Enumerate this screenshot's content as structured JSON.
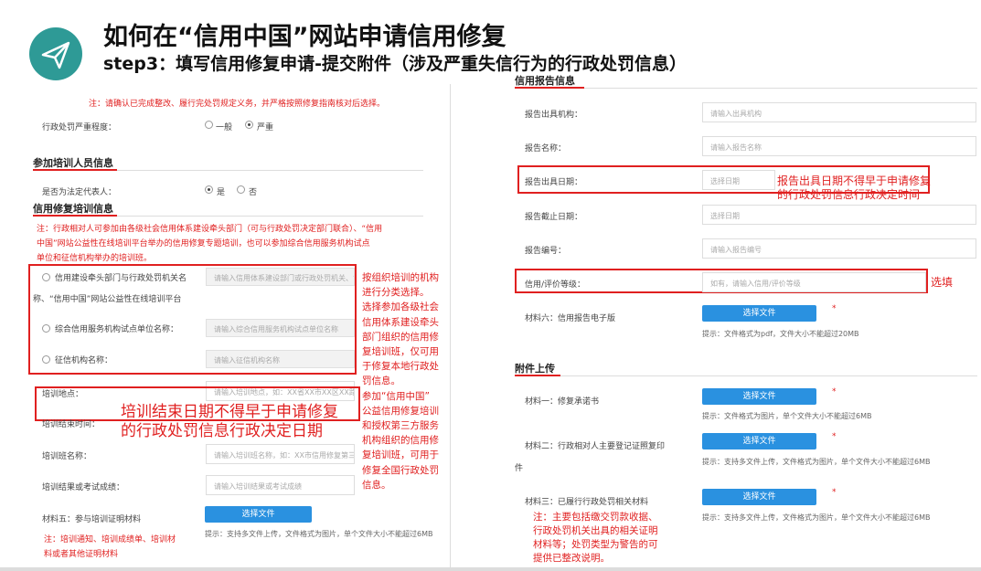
{
  "header": {
    "title": "如何在“信用中国”网站申请信用修复",
    "subtitle": "step3：填写信用修复申请-提交附件（涉及严重失信行为的行政处罚信息）"
  },
  "left": {
    "top_note": "注：请确认已完成整改、履行完处罚规定义务，并严格按照修复指南核对后选择。",
    "severity_label": "行政处罚严重程度：",
    "severity_options": [
      "一般",
      "严重"
    ],
    "section_training_person": "参加培训人员信息",
    "legal_rep_label": "是否为法定代表人：",
    "legal_rep_options": [
      "是",
      "否"
    ],
    "section_training_info": "信用修复培训信息",
    "training_note_1": "注：行政相对人可参加由各级社会信用体系建设牵头部门（可与行政处罚决定部门联合）、“信用",
    "training_note_2": "中国”网站公益性在线培训平台举办的信用修复专题培训，也可以参加综合信用服务机构试点",
    "training_note_3": "单位和征信机构举办的培训班。",
    "org_option_1_line1": "信用建设牵头部门与行政处罚机关名",
    "org_option_1_line2": "称、“信用中国”网站公益性在线培训平台",
    "org_option_1_placeholder": "请输入信用体系建设部门或行政处罚机关、“信",
    "org_option_2": "综合信用服务机构试点单位名称：",
    "org_option_2_placeholder": "请输入综合信用服务机构试点单位名称",
    "org_option_3": "征信机构名称：",
    "org_option_3_placeholder": "请输入征信机构名称",
    "location_label": "培训地点：",
    "location_placeholder": "请输入培训地点，如：XX省XX市XX区XX路XX",
    "time_label": "培训结束时间：",
    "class_name_label": "培训班名称：",
    "class_name_placeholder": "请输入培训班名称，如：XX市信用修复第三期",
    "result_label": "培训结果或考试成绩：",
    "result_placeholder": "请输入培训结果或考试成绩",
    "material5_label": "材料五：参与培训证明材料",
    "select_file": "选择文件",
    "material5_hint": "提示：支持多文件上传，文件格式为图片，单个文件大小不能超过6MB",
    "material5_note_1": "注：培训通知、培训成绩单、培训材",
    "material5_note_2": "料或者其他证明材料",
    "callout_training_date_1": "培训结束日期不得早于申请修复",
    "callout_training_date_2": "的行政处罚信息行政决定日期",
    "callout_org": [
      "按组织培训的机构",
      "进行分类选择。",
      "选择参加各级社会",
      "信用体系建设牵头",
      "部门组织的信用修",
      "复培训班，仅可用",
      "于修复本地行政处",
      "罚信息。",
      "参加“信用中国”",
      "公益信用修复培训",
      "和授权第三方服务",
      "机构组织的信用修",
      "复培训班，可用于",
      "修复全国行政处罚",
      "信息。"
    ]
  },
  "right": {
    "section_report": "信用报告信息",
    "fields": [
      {
        "label": "报告出具机构：",
        "placeholder": "请输入出具机构"
      },
      {
        "label": "报告名称：",
        "placeholder": "请输入报告名称"
      },
      {
        "label": "报告出具日期：",
        "placeholder": "选择日期"
      },
      {
        "label": "报告截止日期：",
        "placeholder": "选择日期"
      },
      {
        "label": "报告编号：",
        "placeholder": "请输入报告编号"
      },
      {
        "label": "信用/评价等级：",
        "placeholder": "如有，请输入信用/评价等级"
      }
    ],
    "callout_report_date_1": "报告出具日期不得早于申请修复",
    "callout_report_date_2": "的行政处罚信息行政决定时间",
    "callout_optional": "选填",
    "material6_label": "材料六：信用报告电子版",
    "material6_hint": "提示：文件格式为pdf，文件大小不能超过20MB",
    "section_attach": "附件上传",
    "material1_label": "材料一：修复承诺书",
    "material1_hint": "提示：文件格式为图片，单个文件大小不能超过6MB",
    "material2_label_1": "材料二：行政相对人主要登记证照复印",
    "material2_label_2": "件",
    "material2_hint": "提示：支持多文件上传，文件格式为图片，单个文件大小不能超过6MB",
    "material3_label": "材料三：已履行行政处罚相关材料",
    "material3_hint": "提示：支持多文件上传，文件格式为图片，单个文件大小不能超过6MB",
    "material3_note": [
      "注：主要包括缴交罚款收据、",
      "行政处罚机关出具的相关证明",
      "材料等；处罚类型为警告的可",
      "提供已整改说明。"
    ],
    "select_file": "选择文件",
    "required_mark": "*"
  },
  "colors": {
    "accent": "#2e9a96",
    "red": "#e02020",
    "button": "#2a91e0"
  },
  "icons": {
    "logo": "paper-plane-icon"
  }
}
